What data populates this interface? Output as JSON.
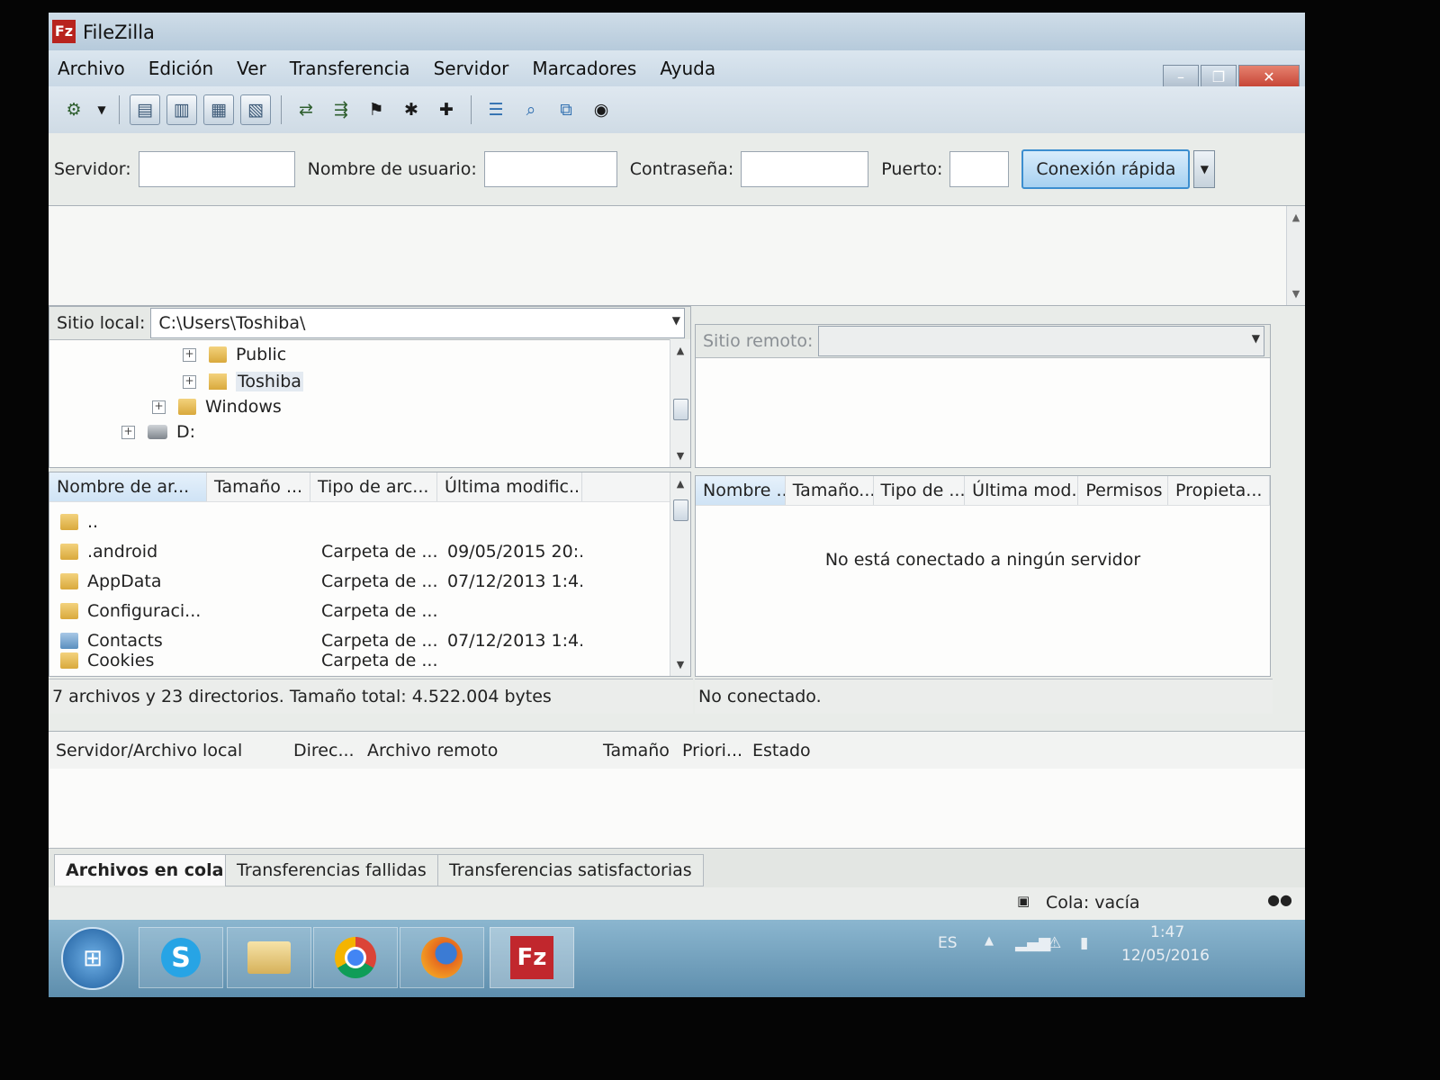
{
  "window": {
    "title": "FileZilla",
    "icon_label": "Fz",
    "controls": [
      "minimize",
      "maximize",
      "close"
    ]
  },
  "menu": [
    "Archivo",
    "Edición",
    "Ver",
    "Transferencia",
    "Servidor",
    "Marcadores",
    "Ayuda"
  ],
  "toolbar_icons": [
    "site-manager-icon",
    "dropdown-arrow-icon",
    "toggle-log-icon",
    "toggle-local-tree-icon",
    "toggle-remote-tree-icon",
    "toggle-queue-icon",
    "refresh-icon",
    "process-queue-icon",
    "cancel-icon",
    "disconnect-icon",
    "reconnect-icon",
    "directory-listing-filters-icon",
    "toggle-compare-icon",
    "sync-browsing-icon",
    "search-icon"
  ],
  "quickconnect": {
    "server_label": "Servidor:",
    "server_value": "",
    "user_label": "Nombre de usuario:",
    "user_value": "",
    "password_label": "Contraseña:",
    "password_value": "",
    "port_label": "Puerto:",
    "port_value": "",
    "button_label": "Conexión rápida"
  },
  "local": {
    "site_label": "Sitio local:",
    "path": "C:\\Users\\Toshiba\\",
    "tree": [
      {
        "name": "Public",
        "level": 2,
        "icon": "folder"
      },
      {
        "name": "Toshiba",
        "level": 2,
        "icon": "user-folder"
      },
      {
        "name": "Windows",
        "level": 1,
        "icon": "folder"
      },
      {
        "name": "D:",
        "level": 0,
        "icon": "drive"
      }
    ],
    "columns": [
      "Nombre de ar...",
      "Tamaño ...",
      "Tipo de arc...",
      "Última modific..."
    ],
    "files": [
      {
        "name": "..",
        "size": "",
        "type": "",
        "modified": ""
      },
      {
        "name": ".android",
        "size": "",
        "type": "Carpeta de ...",
        "modified": "09/05/2015 20:..."
      },
      {
        "name": "AppData",
        "size": "",
        "type": "Carpeta de ...",
        "modified": "07/12/2013 1:4..."
      },
      {
        "name": "Configuraci...",
        "size": "",
        "type": "Carpeta de ...",
        "modified": ""
      },
      {
        "name": "Contacts",
        "size": "",
        "type": "Carpeta de ...",
        "modified": "07/12/2013 1:4..."
      },
      {
        "name": "Cookies",
        "size": "",
        "type": "Carpeta de ...",
        "modified": ""
      }
    ],
    "status": "7 archivos y 23 directorios. Tamaño total: 4.522.004 bytes"
  },
  "remote": {
    "site_label": "Sitio remoto:",
    "path": "",
    "columns": [
      "Nombre ...",
      "Tamaño...",
      "Tipo de ...",
      "Última mod...",
      "Permisos",
      "Propieta..."
    ],
    "empty_message": "No está conectado a ningún servidor",
    "status": "No conectado."
  },
  "queue": {
    "columns": [
      "Servidor/Archivo local",
      "Direc...",
      "Archivo remoto",
      "Tamaño",
      "Priori...",
      "Estado"
    ],
    "tabs": [
      "Archivos en cola",
      "Transferencias fallidas",
      "Transferencias satisfactorias"
    ],
    "status": "Cola: vacía"
  },
  "taskbar": {
    "apps": [
      "start-orb-icon",
      "skype-icon",
      "file-explorer-icon",
      "chrome-icon",
      "firefox-icon",
      "filezilla-icon"
    ],
    "language": "ES",
    "time": "1:47",
    "date": "12/05/2016"
  }
}
